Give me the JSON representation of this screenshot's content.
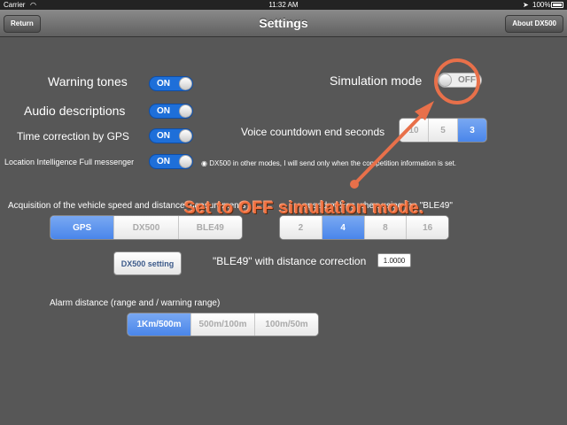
{
  "status": {
    "carrier": "Carrier",
    "time": "11:32 AM",
    "battery": "100%"
  },
  "nav": {
    "title": "Settings",
    "back_label": "Return",
    "about_label": "About DX500"
  },
  "settings": {
    "warning_tones": {
      "label": "Warning tones",
      "state": "ON"
    },
    "audio_descriptions": {
      "label": "Audio descriptions",
      "state": "ON"
    },
    "time_correction": {
      "label": "Time correction by GPS",
      "state": "ON"
    },
    "location_intelligence": {
      "label": "Location Intelligence Full messenger",
      "state": "ON"
    },
    "simulation_mode": {
      "label": "Simulation mode",
      "state": "OFF"
    },
    "voice_countdown": {
      "label": "Voice countdown end seconds",
      "options": [
        "10",
        "5",
        "3"
      ],
      "selected": "3"
    },
    "location_note": "DX500 in other modes, I will send only when the competition information is set.",
    "acquisition": {
      "label": "Acquisition of the vehicle speed and distance measurements",
      "options": [
        "GPS",
        "DX500",
        "BLE49"
      ],
      "selected": "GPS"
    },
    "speed_pulses": {
      "label": "speed pulses when using the \"BLE49\"",
      "options": [
        "2",
        "4",
        "8",
        "16"
      ],
      "selected": "4"
    },
    "dx500_setting_label": "DX500 setting",
    "ble49_correction": {
      "label": "\"BLE49\" with distance correction",
      "value": "1.0000"
    },
    "alarm_distance": {
      "label": "Alarm distance (range and / warning range)",
      "options": [
        "1Km/500m",
        "500m/100m",
        "100m/50m"
      ],
      "selected": "1Km/500m"
    }
  },
  "annotation": {
    "text": "Set to OFF simulation mode.",
    "color": "#f07040"
  }
}
